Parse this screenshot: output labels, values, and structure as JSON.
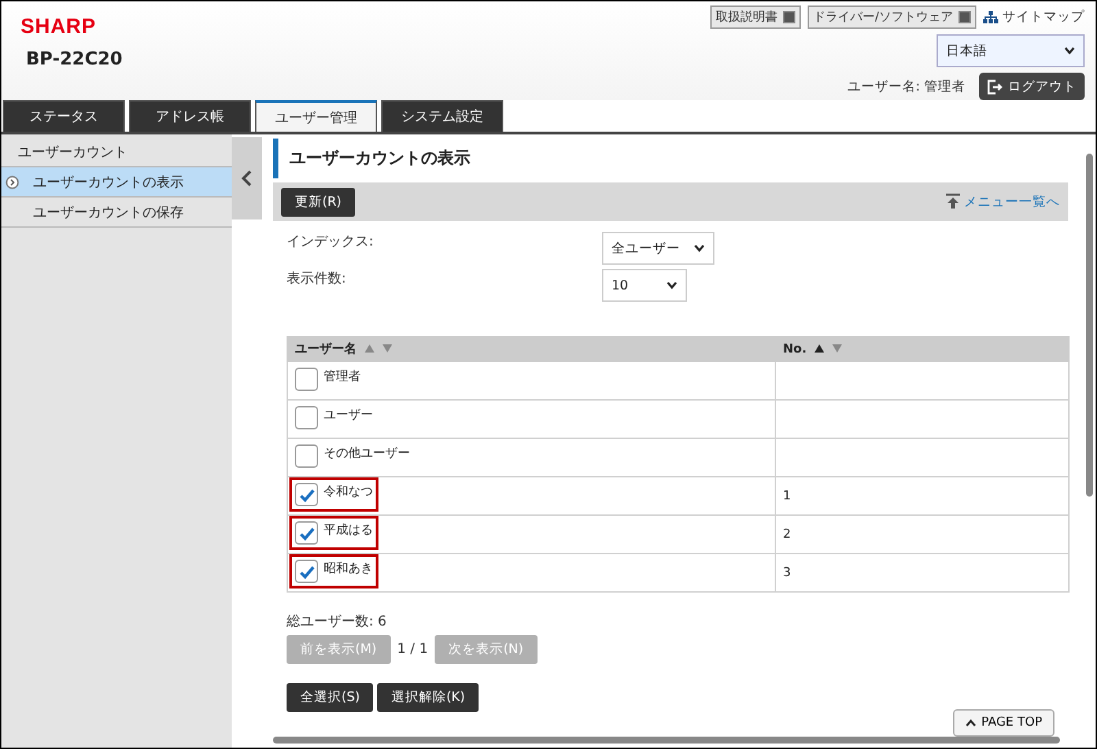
{
  "brand": {
    "logo": "SHARP",
    "model": "BP-22C20"
  },
  "header_links": [
    {
      "label": "取扱説明書"
    },
    {
      "label": "ドライバー/ソフトウェア"
    }
  ],
  "sitemap": "サイトマップ",
  "language": "日本語",
  "user_label": "ユーザー名: 管理者",
  "logout": "ログアウト",
  "tabs": [
    {
      "label": "ステータス",
      "selected": false
    },
    {
      "label": "アドレス帳",
      "selected": false
    },
    {
      "label": "ユーザー管理",
      "selected": true
    },
    {
      "label": "システム設定",
      "selected": false
    }
  ],
  "sidebar": {
    "items": [
      {
        "label": "ユーザーカウント",
        "selected": false,
        "children": [
          {
            "label": "ユーザーカウントの表示",
            "selected": true
          },
          {
            "label": "ユーザーカウントの保存",
            "selected": false
          }
        ]
      }
    ]
  },
  "page_title": "ユーザーカウントの表示",
  "toolbar": {
    "refresh": "更新(R)",
    "menu_link": "メニュー一覧へ"
  },
  "form": [
    {
      "label": "インデックス:",
      "value": "全ユーザー"
    },
    {
      "label": "表示件数:",
      "value": "10"
    }
  ],
  "table": {
    "columns": [
      {
        "label": "ユーザー名"
      },
      {
        "label": "No."
      }
    ],
    "rows": [
      {
        "name": "管理者",
        "no": "",
        "checked": false,
        "highlighted": false
      },
      {
        "name": "ユーザー",
        "no": "",
        "checked": false,
        "highlighted": false
      },
      {
        "name": "その他ユーザー",
        "no": "",
        "checked": false,
        "highlighted": false
      },
      {
        "name": "令和なつ",
        "no": "1",
        "checked": true,
        "highlighted": true
      },
      {
        "name": "平成はる",
        "no": "2",
        "checked": true,
        "highlighted": true
      },
      {
        "name": "昭和あき",
        "no": "3",
        "checked": true,
        "highlighted": true
      }
    ]
  },
  "total": "総ユーザー数:  6",
  "pager": {
    "prev": {
      "label": "前を表示(M)",
      "disabled": true
    },
    "page": "1 / 1",
    "next": {
      "label": "次を表示(N)",
      "disabled": true
    }
  },
  "actions": [
    "全選択(S)",
    "選択解除(K)"
  ],
  "page_top": "PAGE TOP"
}
